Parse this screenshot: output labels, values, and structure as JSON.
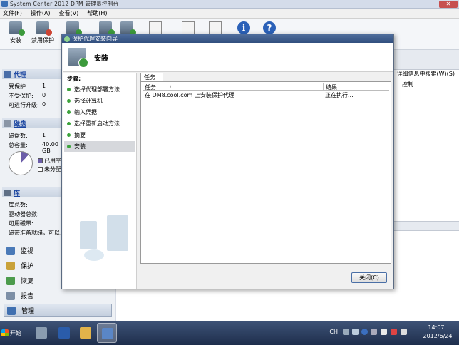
{
  "window": {
    "title": "System Center 2012 DPM 管理员控制台",
    "close_label": "✕"
  },
  "menu": [
    "文件(F)",
    "操作(A)",
    "查看(V)",
    "帮助(H)"
  ],
  "toolbar": {
    "install_label": "安装",
    "disable_label": "禁用保护"
  },
  "left": {
    "agents": {
      "title": "代理",
      "protected_label": "受保护:",
      "protected_value": "1",
      "unprotected_label": "不受保护:",
      "unprotected_value": "0",
      "upgradable_label": "可进行升级:",
      "upgradable_value": "0"
    },
    "disks": {
      "title": "磁盘",
      "count_label": "磁盘数:",
      "count_value": "1",
      "capacity_label": "总容量:",
      "capacity_value": "40.00 GB",
      "used_label": "已用空",
      "unalloc_label": "未分配",
      "used_fraction": 0.12
    },
    "library": {
      "title": "库",
      "l1": "库总数:",
      "l2": "驱动器总数:",
      "l3": "可用磁带:",
      "l4": "磁带准备就绪，可以进"
    },
    "nav": [
      "监视",
      "保护",
      "恢复",
      "报告",
      "管理"
    ]
  },
  "right": {
    "search_hint": "详细信息中搜索(W)(S)",
    "col": "控制"
  },
  "dialog": {
    "title": "保护代理安装向导",
    "header": "安装",
    "steps_label": "步骤:",
    "steps": [
      "选择代理部署方法",
      "选择计算机",
      "输入凭据",
      "选择重新启动方法",
      "摘要",
      "安装"
    ],
    "tab_label": "任务",
    "col_task": "任务",
    "col_sort": "\\",
    "col_result": "结果",
    "row_task": "在 DM8.cool.com 上安装保护代理",
    "row_result": "正在执行...",
    "close_label": "关闭(C)"
  },
  "taskbar": {
    "start_label": "开始",
    "lang": "CH",
    "time": "14:07",
    "date": "2012/6/24"
  }
}
